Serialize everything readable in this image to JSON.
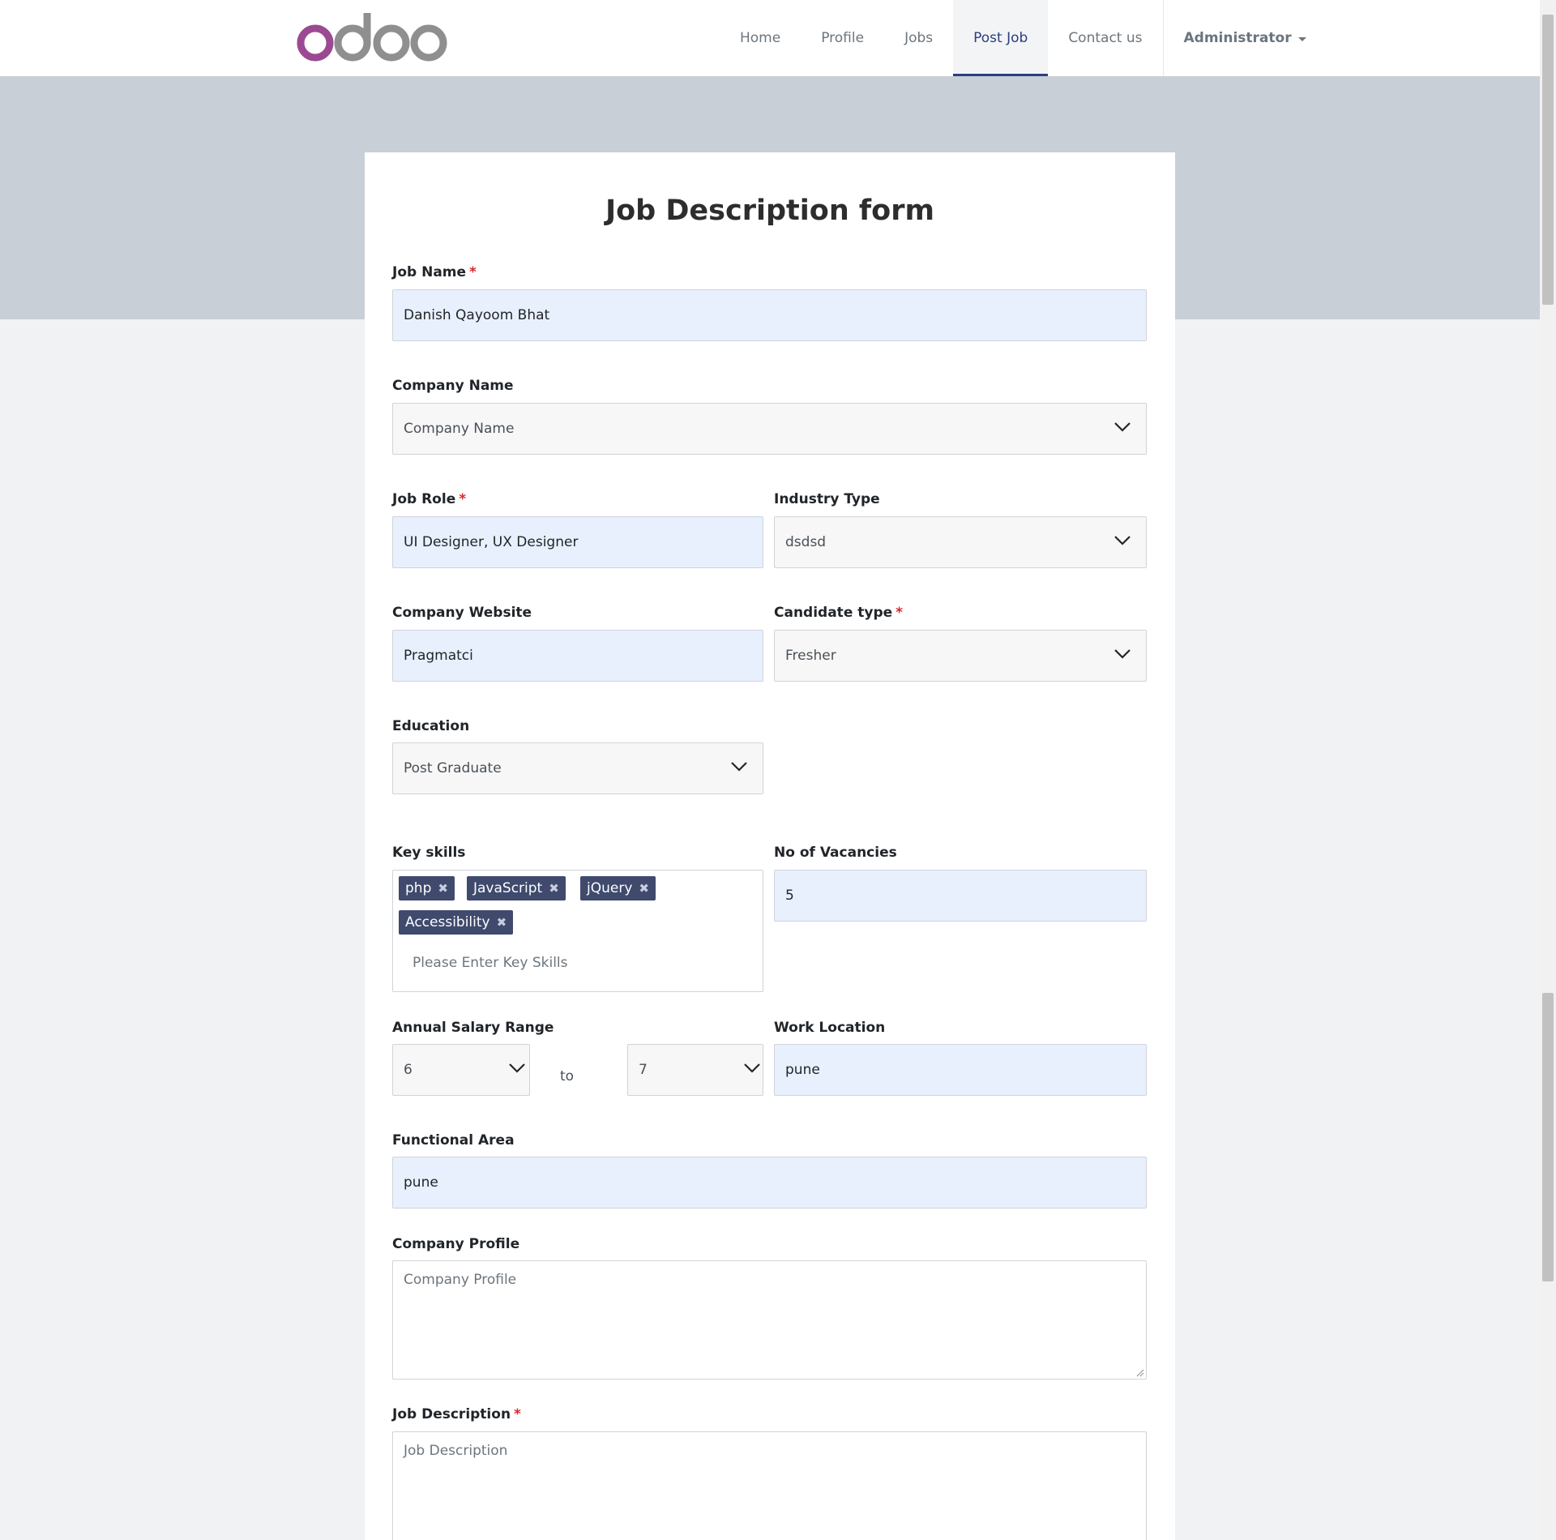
{
  "header": {
    "logo_text": "odoo",
    "nav": [
      "Home",
      "Profile",
      "Jobs",
      "Post Job",
      "Contact us"
    ],
    "active_nav": "Post Job",
    "admin_label": "Administrator"
  },
  "form": {
    "title": "Job Description form",
    "job_name": {
      "label": "Job Name",
      "value": "Danish Qayoom Bhat",
      "required": true
    },
    "company_name": {
      "label": "Company Name",
      "placeholder": "Company Name"
    },
    "job_role": {
      "label": "Job Role",
      "value": "UI Designer, UX Designer",
      "required": true
    },
    "industry_type": {
      "label": "Industry Type",
      "value": "dsdsd"
    },
    "company_website": {
      "label": "Company Website",
      "value": "Pragmatci"
    },
    "candidate_type": {
      "label": "Candidate type",
      "value": "Fresher",
      "required": true
    },
    "education": {
      "label": "Education",
      "value": "Post Graduate"
    },
    "key_skills": {
      "label": "Key skills",
      "tags": [
        "php",
        "JavaScript",
        "jQuery",
        "Accessibility"
      ],
      "placeholder": "Please Enter Key Skills"
    },
    "vacancies": {
      "label": "No of Vacancies",
      "value": "5"
    },
    "salary": {
      "label": "Annual Salary Range",
      "min": "6",
      "to": "to",
      "max": "7"
    },
    "work_location": {
      "label": "Work Location",
      "value": "pune"
    },
    "functional_area": {
      "label": "Functional Area",
      "value": "pune"
    },
    "company_profile": {
      "label": "Company Profile",
      "placeholder": "Company Profile"
    },
    "job_description": {
      "label": "Job Description",
      "placeholder": "Job Description",
      "required": true
    }
  },
  "colors": {
    "accent": "#2c3e80",
    "tag": "#3f4a6d",
    "filled_input": "#e8f0fe",
    "hero": "#c8cfd6",
    "logo_o": "#9b4993",
    "logo_doo": "#8f8f8f"
  }
}
